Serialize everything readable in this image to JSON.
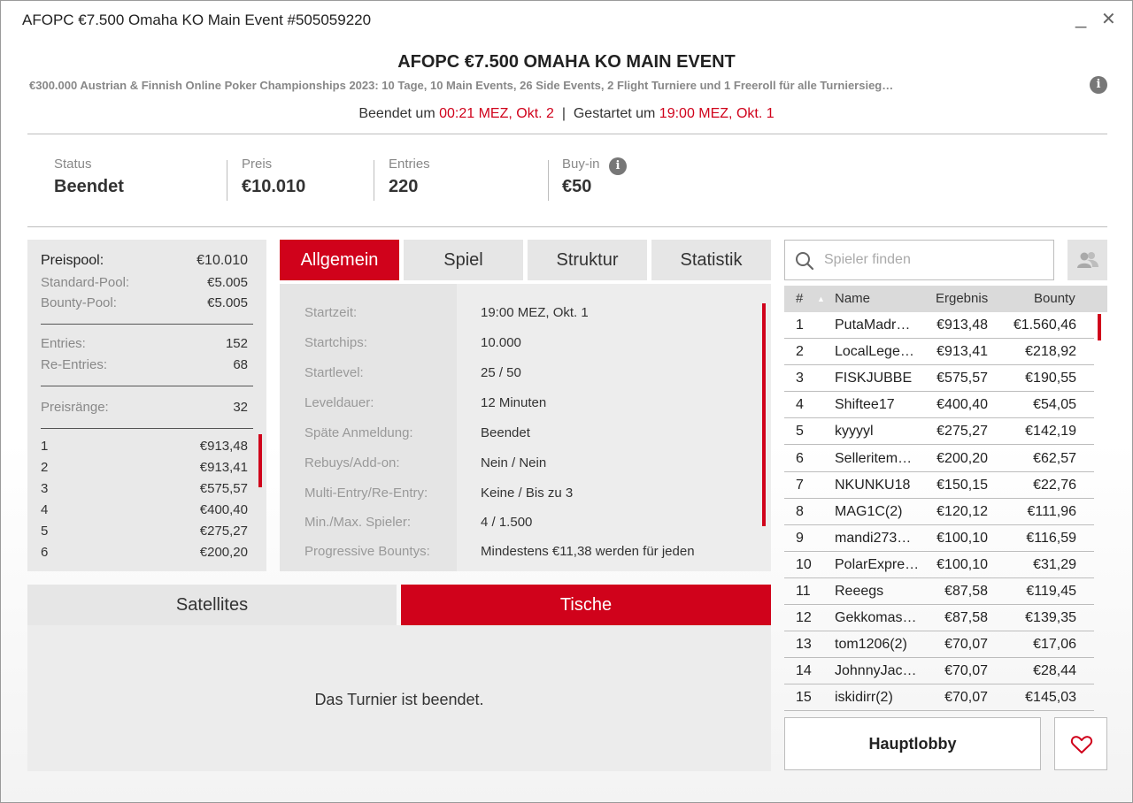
{
  "window": {
    "title": "AFOPC €7.500 Omaha KO Main Event #505059220",
    "minimize": "_",
    "close": "✕"
  },
  "header": {
    "title": "AFOPC €7.500 OMAHA KO MAIN EVENT",
    "subtitle": "€300.000 Austrian & Finnish Online Poker Championships 2023: 10 Tage, 10 Main Events, 26 Side Events, 2 Flight Turniere und 1 Freeroll für alle Turniersieg…",
    "ended_label": "Beendet um",
    "ended_time": "00:21 MEZ, Okt. 2",
    "divider": "|",
    "started_label": "Gestartet um",
    "started_time": "19:00 MEZ, Okt. 1",
    "info_glyph": "i",
    "accent_color": "#d0021b"
  },
  "stats": {
    "status_label": "Status",
    "status_value": "Beendet",
    "prize_label": "Preis",
    "prize_value": "€10.010",
    "entries_label": "Entries",
    "entries_value": "220",
    "buyin_label": "Buy-in",
    "buyin_value": "€50"
  },
  "prizepool": {
    "pool_label": "Preispool:",
    "pool_value": "€10.010",
    "standard_label": "Standard-Pool:",
    "standard_value": "€5.005",
    "bounty_label": "Bounty-Pool:",
    "bounty_value": "€5.005",
    "entries_label": "Entries:",
    "entries_value": "152",
    "reentries_label": "Re-Entries:",
    "reentries_value": "68",
    "ranks_label": "Preisränge:",
    "ranks_value": "32",
    "places": [
      {
        "rank": "1",
        "amount": "€913,48"
      },
      {
        "rank": "2",
        "amount": "€913,41"
      },
      {
        "rank": "3",
        "amount": "€575,57"
      },
      {
        "rank": "4",
        "amount": "€400,40"
      },
      {
        "rank": "5",
        "amount": "€275,27"
      },
      {
        "rank": "6",
        "amount": "€200,20"
      }
    ]
  },
  "tabs": [
    "Allgemein",
    "Spiel",
    "Struktur",
    "Statistik"
  ],
  "details": [
    {
      "label": "Startzeit:",
      "value": "19:00 MEZ, Okt. 1"
    },
    {
      "label": "Startchips:",
      "value": "10.000"
    },
    {
      "label": "Startlevel:",
      "value": "25 / 50"
    },
    {
      "label": "Leveldauer:",
      "value": "12 Minuten"
    },
    {
      "label": "Späte Anmeldung:",
      "value": "Beendet"
    },
    {
      "label": "Rebuys/Add-on:",
      "value": "Nein / Nein"
    },
    {
      "label": "Multi-Entry/Re-Entry:",
      "value": "Keine / Bis zu 3"
    },
    {
      "label": "Min./Max. Spieler:",
      "value": "4 / 1.500"
    },
    {
      "label": "Progressive Bountys:",
      "value": "Mindestens €11,38 werden für jeden"
    }
  ],
  "bottom_tabs": {
    "satellites": "Satellites",
    "tables": "Tische",
    "message": "Das Turnier ist beendet."
  },
  "search": {
    "placeholder": "Spieler finden",
    "icon": "search-icon"
  },
  "players": {
    "columns": {
      "rank": "#",
      "sort_glyph": "▲",
      "name": "Name",
      "result": "Ergebnis",
      "bounty": "Bounty"
    },
    "rows": [
      {
        "rank": "1",
        "name": "PutaMadr…",
        "result": "€913,48",
        "bounty": "€1.560,46"
      },
      {
        "rank": "2",
        "name": "LocalLege…",
        "result": "€913,41",
        "bounty": "€218,92"
      },
      {
        "rank": "3",
        "name": "FISKJUBBE",
        "result": "€575,57",
        "bounty": "€190,55"
      },
      {
        "rank": "4",
        "name": "Shiftee17",
        "result": "€400,40",
        "bounty": "€54,05"
      },
      {
        "rank": "5",
        "name": "kyyyyl",
        "result": "€275,27",
        "bounty": "€142,19"
      },
      {
        "rank": "6",
        "name": "Selleritem…",
        "result": "€200,20",
        "bounty": "€62,57"
      },
      {
        "rank": "7",
        "name": "NKUNKU18",
        "result": "€150,15",
        "bounty": "€22,76"
      },
      {
        "rank": "8",
        "name": "MAG1C(2)",
        "result": "€120,12",
        "bounty": "€111,96"
      },
      {
        "rank": "9",
        "name": "mandi273…",
        "result": "€100,10",
        "bounty": "€116,59"
      },
      {
        "rank": "10",
        "name": "PolarExpre…",
        "result": "€100,10",
        "bounty": "€31,29"
      },
      {
        "rank": "11",
        "name": "Reeegs",
        "result": "€87,58",
        "bounty": "€119,45"
      },
      {
        "rank": "12",
        "name": "Gekkomas…",
        "result": "€87,58",
        "bounty": "€139,35"
      },
      {
        "rank": "13",
        "name": "tom1206(2)",
        "result": "€70,07",
        "bounty": "€17,06"
      },
      {
        "rank": "14",
        "name": "JohnnyJac…",
        "result": "€70,07",
        "bounty": "€28,44"
      },
      {
        "rank": "15",
        "name": "iskidirr(2)",
        "result": "€70,07",
        "bounty": "€145,03"
      }
    ]
  },
  "footer": {
    "lobby_label": "Hauptlobby",
    "favorite_icon": "heart-icon"
  }
}
